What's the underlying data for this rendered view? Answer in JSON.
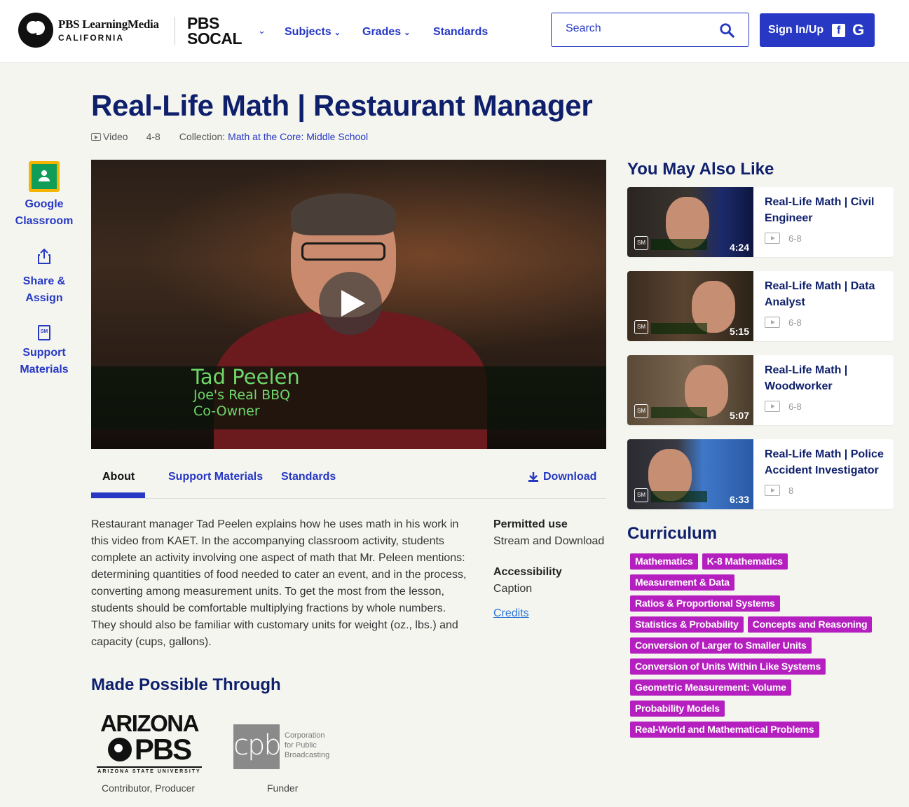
{
  "header": {
    "logo_line1": "PBS LearningMedia",
    "logo_line2": "CALIFORNIA",
    "station_line1": "PBS",
    "station_line2": "SOCAL",
    "nav": [
      {
        "label": "Subjects"
      },
      {
        "label": "Grades"
      },
      {
        "label": "Standards"
      }
    ],
    "search_placeholder": "Search",
    "signin_label": "Sign In/Up"
  },
  "resource": {
    "title": "Real-Life Math | Restaurant Manager",
    "type": "Video",
    "grades": "4-8",
    "collection_label": "Collection:",
    "collection": "Math at the Core: Middle School"
  },
  "rail": {
    "google_classroom": "Google Classroom",
    "share_assign": "Share & Assign",
    "support_materials": "Support Materials"
  },
  "video": {
    "name": "Tad Peelen",
    "line1": "Joe's Real BBQ",
    "line2": "Co-Owner"
  },
  "tabs": {
    "about": "About",
    "support": "Support Materials",
    "standards": "Standards",
    "download": "Download"
  },
  "about": {
    "text": "Restaurant manager Tad Peelen explains how he uses math in his work in this video from KAET. In the accompanying classroom activity, students complete an activity involving one aspect of math that Mr. Peleen mentions: determining quantities of food needed to cater an event, and in the process, converting among measurement units. To get the most from the lesson, students should be comfortable multiplying fractions by whole numbers. They should also be familiar with customary units for weight (oz., lbs.) and capacity (cups, gallons).",
    "permitted_label": "Permitted use",
    "permitted_value": "Stream and Download",
    "access_label": "Accessibility",
    "access_value": "Caption",
    "credits": "Credits"
  },
  "made_possible": {
    "title": "Made Possible Through",
    "az_line1": "ARIZONA",
    "az_line2": "PBS",
    "az_line3": "ARIZONA STATE UNIVERSITY",
    "az_caption": "Contributor, Producer",
    "cpb_mark": "cpb",
    "cpb_line1": "Corporation",
    "cpb_line2": "for Public",
    "cpb_line3": "Broadcasting",
    "cpb_caption": "Funder"
  },
  "also_like": {
    "title": "You May Also Like",
    "items": [
      {
        "title": "Real-Life Math | Civil Engineer",
        "grades": "6-8",
        "duration": "4:24"
      },
      {
        "title": "Real-Life Math | Data Analyst",
        "grades": "6-8",
        "duration": "5:15"
      },
      {
        "title": "Real-Life Math | Woodworker",
        "grades": "6-8",
        "duration": "5:07"
      },
      {
        "title": "Real-Life Math | Police Accident Investigator",
        "grades": "8",
        "duration": "6:33"
      }
    ]
  },
  "curriculum": {
    "title": "Curriculum",
    "tags": [
      "Mathematics",
      "K-8 Mathematics",
      "Measurement & Data",
      "Ratios & Proportional Systems",
      "Statistics & Probability",
      "Concepts and Reasoning",
      "Conversion of Larger to Smaller Units",
      "Conversion of Units Within Like Systems",
      "Geometric Measurement: Volume",
      "Probability Models",
      "Real-World and Mathematical Problems"
    ]
  },
  "colors": {
    "brand_blue": "#2638c4",
    "heading_navy": "#0e1f6b",
    "tag_magenta": "#b51fbf"
  }
}
